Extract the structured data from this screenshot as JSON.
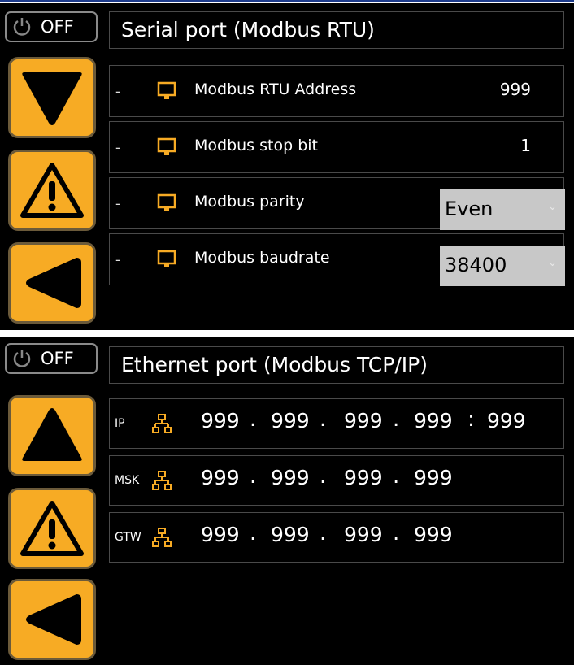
{
  "serial": {
    "power_label": "OFF",
    "title": "Serial port (Modbus RTU)",
    "rows": [
      {
        "prefix": "-",
        "label": "Modbus RTU Address",
        "value": "999"
      },
      {
        "prefix": "-",
        "label": "Modbus stop bit",
        "value": "1"
      },
      {
        "prefix": "-",
        "label": "Modbus parity",
        "value": "Even"
      },
      {
        "prefix": "-",
        "label": "Modbus baudrate",
        "value": "38400"
      }
    ]
  },
  "ethernet": {
    "power_label": "OFF",
    "title": "Ethernet port (Modbus TCP/IP)",
    "ip": {
      "label": "IP",
      "octets": [
        "999",
        "999",
        "999",
        "999"
      ],
      "port": "999"
    },
    "mask": {
      "label": "MSK",
      "octets": [
        "999",
        "999",
        "999",
        "999"
      ]
    },
    "gateway": {
      "label": "GTW",
      "octets": [
        "999",
        "999",
        "999",
        "999"
      ]
    }
  },
  "icons": {
    "power": "power-icon",
    "monitor": "monitor-icon",
    "network": "network-icon",
    "down": "down-arrow-icon",
    "up": "up-arrow-icon",
    "warning": "warning-icon",
    "back": "back-arrow-icon"
  },
  "colors": {
    "button_fill": "#f7ab24",
    "background": "#000000",
    "select_bg": "#c8c8c8",
    "icon_accent": "#f7ab24"
  }
}
